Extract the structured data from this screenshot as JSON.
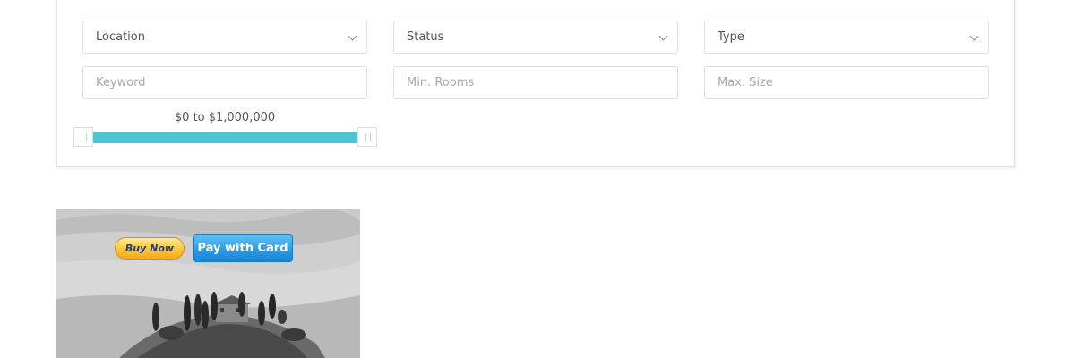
{
  "filters": {
    "location": {
      "value": "Location"
    },
    "status": {
      "value": "Status"
    },
    "type": {
      "value": "Type"
    },
    "keyword": {
      "placeholder": "Keyword"
    },
    "min_rooms": {
      "placeholder": "Min. Rooms"
    },
    "max_size": {
      "placeholder": "Max. Size"
    }
  },
  "price_range": {
    "label": "$0 to $1,000,000",
    "min": 0,
    "max": 1000000,
    "accent_color": "#4ec3d1"
  },
  "payment": {
    "buy_now_label": "Buy Now",
    "pay_with_card_label": "Pay with Card"
  }
}
